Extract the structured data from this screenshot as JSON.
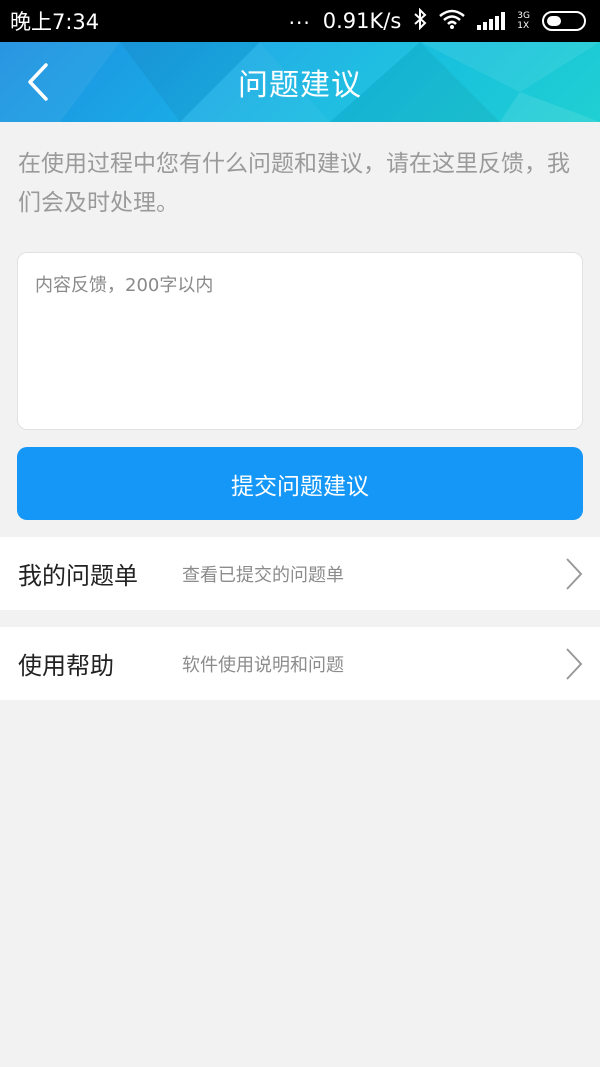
{
  "status_bar": {
    "time": "晚上7:34",
    "dots": "...",
    "speed": "0.91K/s",
    "network_top": "3G",
    "network_bottom": "1X",
    "icons": [
      "bluetooth-icon",
      "wifi-icon",
      "signal-icon",
      "battery-icon"
    ]
  },
  "header": {
    "title": "问题建议",
    "back_icon": "back-arrow-icon"
  },
  "intro_text": "在使用过程中您有什么问题和建议，请在这里反馈，我们会及时处理。",
  "feedback": {
    "placeholder": "内容反馈，200字以内",
    "value": ""
  },
  "submit_label": "提交问题建议",
  "menu": [
    {
      "title": "我的问题单",
      "subtitle": "查看已提交的问题单",
      "icon": "chevron-right-icon"
    },
    {
      "title": "使用帮助",
      "subtitle": "软件使用说明和问题",
      "icon": "chevron-right-icon"
    }
  ],
  "colors": {
    "accent": "#1597f8",
    "header_start": "#1d8fe0",
    "header_end": "#1fd0d2",
    "background": "#f2f2f2"
  }
}
